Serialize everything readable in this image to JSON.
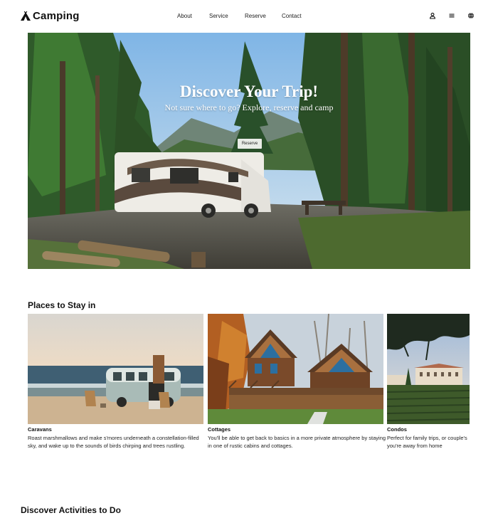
{
  "header": {
    "logo_text": "Camping",
    "logo_icon": "tent-icon",
    "nav": [
      {
        "label": "About"
      },
      {
        "label": "Service"
      },
      {
        "label": "Reserve"
      },
      {
        "label": "Contact"
      }
    ],
    "icons": [
      "user-icon",
      "menu-icon",
      "globe-icon"
    ]
  },
  "hero": {
    "title": "Discover Your Trip!",
    "subtitle": "Not sure where to go? Explore, reserve and camp",
    "button_label": "Reserve"
  },
  "places": {
    "title": "Places to Stay in",
    "cards": [
      {
        "title": "Caravans",
        "description": "Roast marshmallows and make s'mores underneath a constellation-filled sky, and wake up to the sounds of birds chirping and trees rustling."
      },
      {
        "title": "Cottages",
        "description": "You'll be able to get back to basics in a more private atmosphere by staying in one of rustic cabins and cottages."
      },
      {
        "title": "Condos",
        "description": "Perfect for family trips, or couple's you're away from home"
      }
    ]
  },
  "activities": {
    "title": "Discover Activities to Do"
  },
  "colors": {
    "text": "#111111",
    "button_bg": "#e9ece7",
    "background": "#ffffff"
  }
}
